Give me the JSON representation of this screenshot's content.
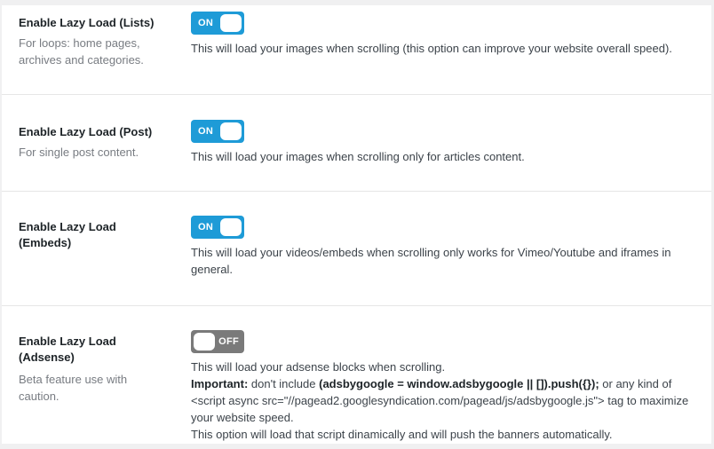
{
  "settings": [
    {
      "title": "Enable Lazy Load (Lists)",
      "subtitle": "For loops: home pages, archives and categories.",
      "toggle": "ON",
      "state": "on",
      "description": "This will load your images when scrolling (this option can improve your website overall speed)."
    },
    {
      "title": "Enable Lazy Load (Post)",
      "subtitle": "For single post content.",
      "toggle": "ON",
      "state": "on",
      "description": "This will load your images when scrolling only for articles content."
    },
    {
      "title": "Enable Lazy Load (Embeds)",
      "subtitle": "",
      "toggle": "ON",
      "state": "on",
      "description": "This will load your videos/embeds when scrolling only works for Vimeo/Youtube and iframes in general."
    },
    {
      "title": "Enable Lazy Load (Adsense)",
      "subtitle": "Beta feature use with caution.",
      "toggle": "OFF",
      "state": "off",
      "description": "This will load your adsense blocks when scrolling.",
      "important_label": "Important:",
      "important_text_1": " don't include ",
      "important_code": "(adsbygoogle = window.adsbygoogle || []).push({});",
      "important_text_2": " or any kind of <script async src=\"//pagead2.googlesyndication.com/pagead/js/adsbygoogle.js\"> tag to maximize your website speed.",
      "extra": "This option will load that script dinamically and will push the banners automatically."
    }
  ],
  "colors": {
    "toggle_on": "#1e9bd7",
    "toggle_off": "#7a7a7a"
  }
}
